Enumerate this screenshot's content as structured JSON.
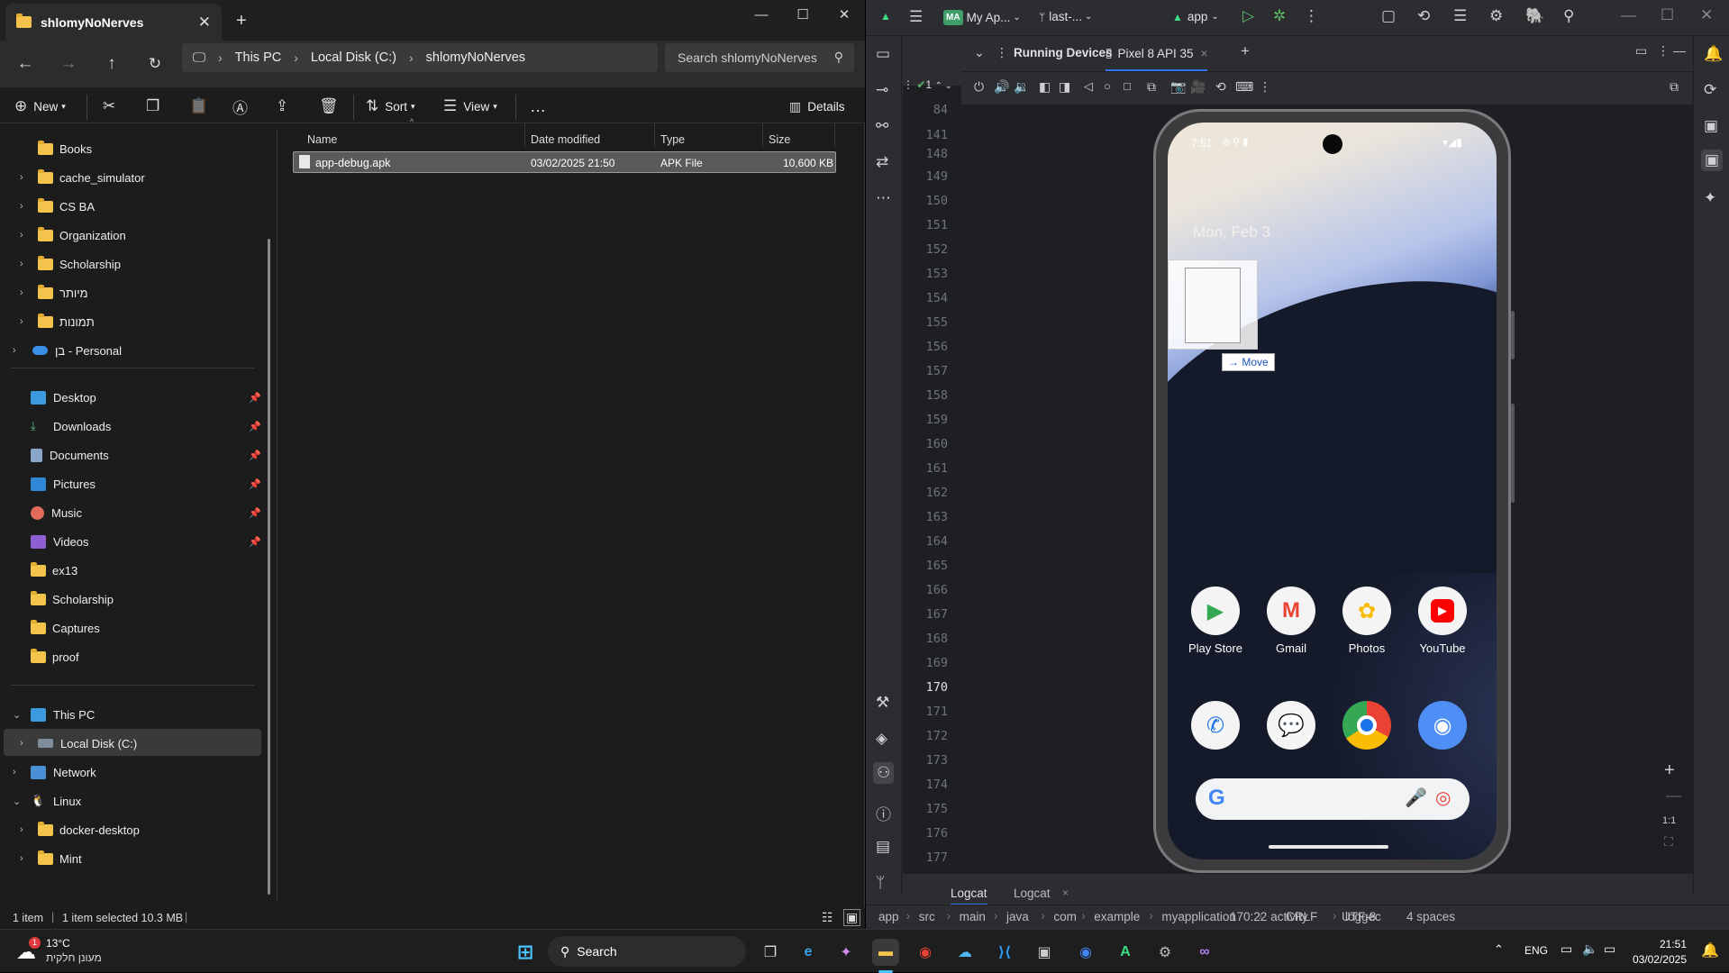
{
  "explorer": {
    "tab_title": "shlomyNoNerves",
    "breadcrumb": [
      "This PC",
      "Local Disk (C:)",
      "shlomyNoNerves"
    ],
    "search_placeholder": "Search shlomyNoNerves",
    "toolbar": {
      "new": "New",
      "sort": "Sort",
      "view": "View",
      "more": "…",
      "details": "Details"
    },
    "sidebar": {
      "folders": [
        "Books",
        "cache_simulator",
        "CS BA",
        "Organization",
        "Scholarship",
        "מיותר",
        "תמונות"
      ],
      "onedrive": "בן - Personal",
      "quick_access": [
        "Desktop",
        "Downloads",
        "Documents",
        "Pictures",
        "Music",
        "Videos",
        "ex13",
        "Scholarship",
        "Captures",
        "proof"
      ],
      "this_pc": "This PC",
      "local_disk": "Local Disk (C:)",
      "network": "Network",
      "linux": "Linux",
      "linux_children": [
        "docker-desktop",
        "Mint"
      ]
    },
    "columns": [
      "Name",
      "Date modified",
      "Type",
      "Size"
    ],
    "files": [
      {
        "name": "app-debug.apk",
        "date": "03/02/2025 21:50",
        "type": "APK File",
        "size": "10,600 KB"
      }
    ],
    "status": {
      "items": "1 item",
      "selected": "1 item selected  10.3 MB"
    }
  },
  "studio": {
    "project_badge": "MA",
    "project": "My Ap...",
    "branch": "last-...",
    "run_config": "app",
    "tab_running_devices": "Running Devices",
    "tab_device": "Pixel 8 API 35",
    "inspection_count": "1",
    "line_numbers": [
      "84",
      "141",
      "148",
      "149",
      "150",
      "151",
      "152",
      "153",
      "154",
      "155",
      "156",
      "157",
      "158",
      "159",
      "160",
      "161",
      "162",
      "163",
      "164",
      "165",
      "166",
      "167",
      "168",
      "169",
      "170",
      "171",
      "172",
      "173",
      "174",
      "175",
      "176",
      "177"
    ],
    "current_line": "170",
    "bottom_tabs": [
      "Logcat",
      "Logcat"
    ],
    "breadcrumb": [
      "app",
      "src",
      "main",
      "java",
      "com",
      "example",
      "myapplication",
      "activity",
      "loggeс"
    ],
    "position": "170:22",
    "line_ending": "CRLF",
    "encoding": "UTF-8",
    "indent": "4 spaces",
    "zoom_label": "1:1"
  },
  "phone": {
    "time": "7:51",
    "date": "Mon, Feb 3",
    "drag_label": "Move",
    "apps_row1": [
      "Play Store",
      "Gmail",
      "Photos",
      "YouTube"
    ]
  },
  "taskbar": {
    "weather_temp": "13°C",
    "weather_desc": "מעונן חלקית",
    "weather_badge": "1",
    "search": "Search",
    "lang": "ENG",
    "time": "21:51",
    "date": "03/02/2025"
  },
  "colors": {
    "accent_blue": "#0078d4",
    "folder": "#f4c34c",
    "studio_bg": "#2b2d30"
  }
}
